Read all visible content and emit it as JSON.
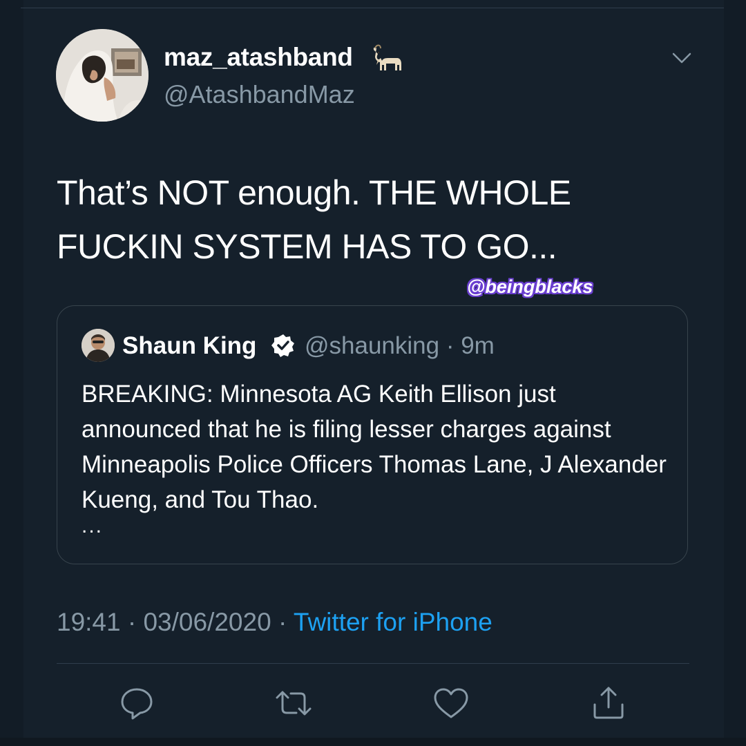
{
  "author": {
    "display_name": "maz_atashband",
    "handle": "@AtashbandMaz",
    "name_emoji": "goat-icon"
  },
  "tweet": {
    "text": "That’s NOT enough. THE WHOLE FUCKIN SYSTEM HAS TO GO..."
  },
  "watermark": "@beingblacks",
  "quoted_tweet": {
    "display_name": "Shaun King",
    "verified": "verified-icon",
    "handle_time": "@shaunking · 9m",
    "text": "BREAKING: Minnesota AG Keith Ellison just announced that he is filing lesser charges against Minneapolis Police Officers Thomas Lane, J Alexander Kueng, and Tou Thao.",
    "ellipsis": "..."
  },
  "meta": {
    "time": "19:41",
    "separator1": "·",
    "date": "03/06/2020",
    "separator2": "·",
    "source": "Twitter for iPhone"
  },
  "actions": [
    "reply-icon",
    "retweet-icon",
    "like-icon",
    "share-icon"
  ],
  "colors": {
    "background": "#15202b",
    "secondary_text": "#8899a6",
    "link": "#1da1f2",
    "border": "#38444d"
  }
}
